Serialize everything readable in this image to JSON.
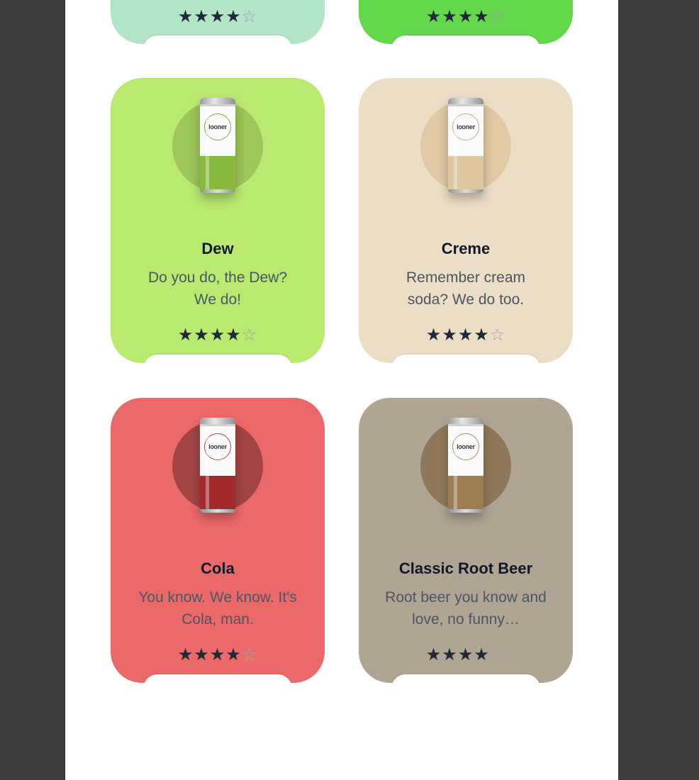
{
  "rating_stars": {
    "filled_glyph": "★",
    "empty_glyph": "☆"
  },
  "top_cards": [
    {
      "bg": "#b2e5c7",
      "rating": 4
    },
    {
      "bg": "#62d84a",
      "rating": 4
    }
  ],
  "cards": [
    {
      "name": "Dew",
      "description": "Do you do, the Dew? We do!",
      "rating": 4,
      "bg": "#b8ea70",
      "circle": "#9dc65b",
      "can_color": "#86b93c",
      "brand": "looner",
      "accent": "#7cae3c"
    },
    {
      "name": "Creme",
      "description": "Remember cream soda? We do too.",
      "rating": 4,
      "bg": "#ecdec5",
      "circle": "#e1c9a4",
      "can_color": "#dcc79e",
      "brand": "looner",
      "accent": "#c9ae7a"
    },
    {
      "name": "Cola",
      "description": "You know. We know. It's Cola, man.",
      "rating": 4,
      "bg": "#eb6968",
      "circle": "#a34444",
      "can_color": "#a22a2a",
      "brand": "looner",
      "accent": "#b74545"
    },
    {
      "name": "Classic Root Beer",
      "description": "Root beer you know and love, no funny…",
      "rating": 4,
      "bg": "#afa592",
      "circle": "#8f7859",
      "can_color": "#9b7d50",
      "brand": "looner",
      "accent": "#a88c60"
    }
  ]
}
